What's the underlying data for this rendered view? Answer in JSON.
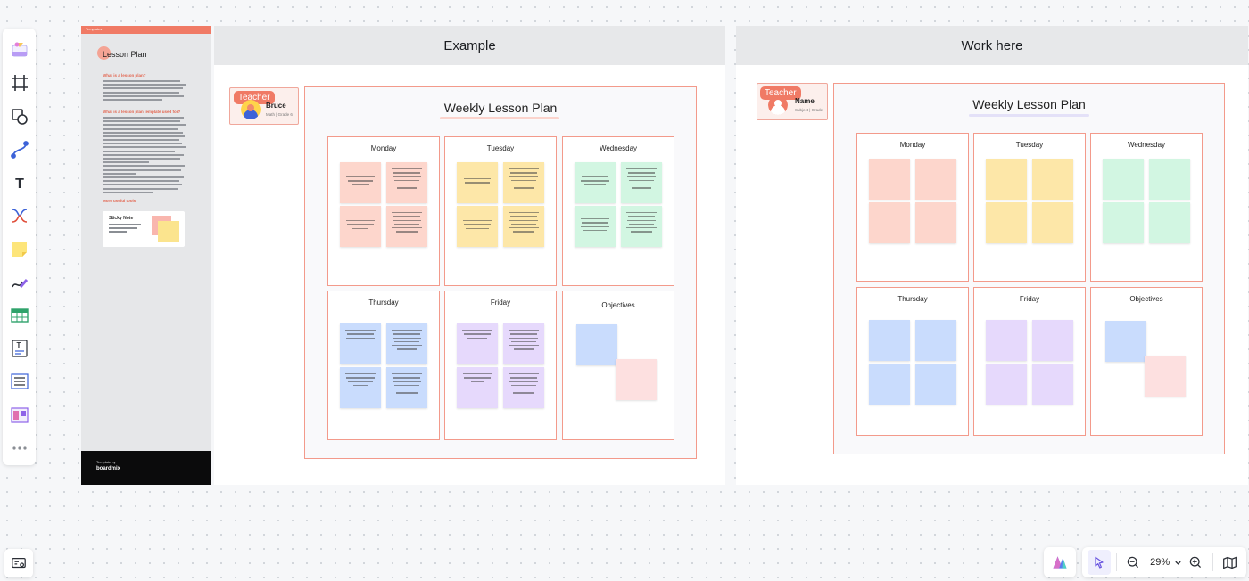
{
  "toolbar": {
    "tools": [
      "template-icon",
      "frame-icon",
      "shape-icon",
      "connector-icon",
      "text-icon",
      "mindmap-icon",
      "sticky-note-icon",
      "pen-icon",
      "table-icon",
      "text-block-icon",
      "list-icon",
      "kanban-icon",
      "more-icon"
    ]
  },
  "template_panel": {
    "header": "Templates",
    "title": "Lesson Plan",
    "section1": "What is a lesson plan?",
    "section2": "What is a lesson plan template used for?",
    "section3": "More useful tools",
    "card_title": "Sticky Note",
    "footer_small": "Template by",
    "footer_brand": "boardmix"
  },
  "frames": {
    "example": {
      "title": "Example"
    },
    "work": {
      "title": "Work here"
    }
  },
  "example": {
    "teacher_tag": "Teacher",
    "teacher_name": "Bruce",
    "teacher_sub": "Math | Grade 6",
    "plan_title": "Weekly Lesson Plan",
    "days": [
      "Monday",
      "Tuesday",
      "Wednesday",
      "Thursday",
      "Friday",
      "Objectives"
    ]
  },
  "work": {
    "teacher_tag": "Teacher",
    "teacher_name": "Name",
    "teacher_sub": "Subject | Grade",
    "plan_title": "Weekly Lesson Plan",
    "days": [
      "Monday",
      "Tuesday",
      "Wednesday",
      "Thursday",
      "Friday",
      "Objectives"
    ]
  },
  "colors": {
    "monday": "#fdd6cc",
    "tuesday": "#fde7a8",
    "wednesday": "#d2f6e2",
    "thursday": "#c9dcfd",
    "friday": "#e6d9fc",
    "objective_blue": "#c9dcfd",
    "objective_pink": "#fde0e0",
    "accent": "#f07a65"
  },
  "bottom_bar": {
    "zoom": "29%"
  }
}
